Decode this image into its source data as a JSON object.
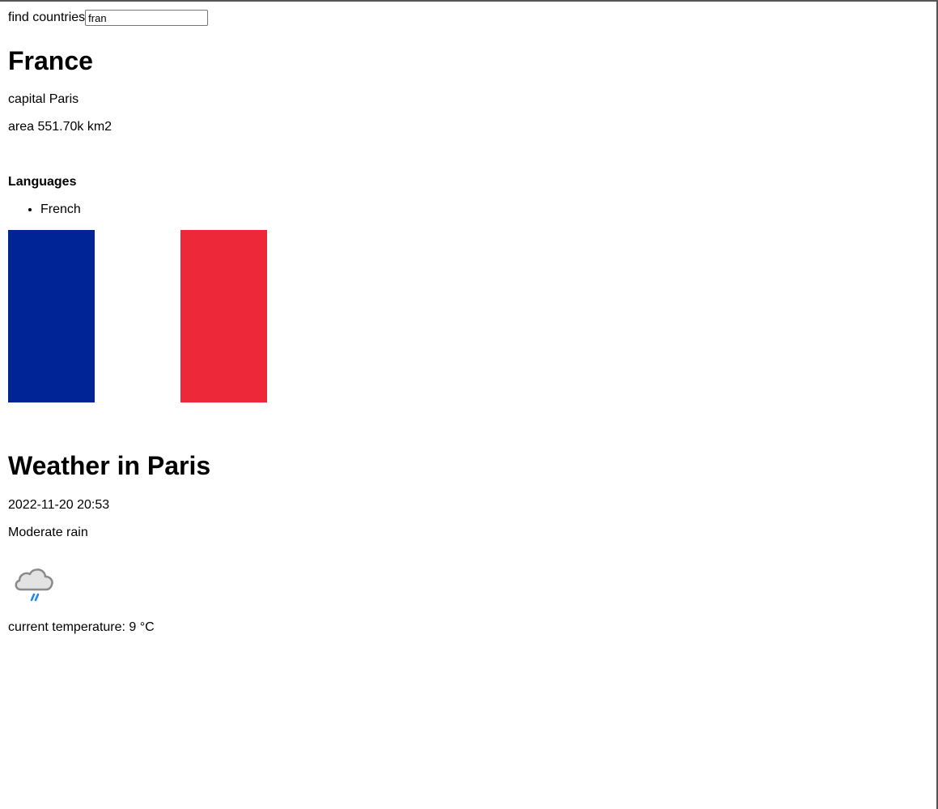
{
  "search": {
    "label": "find countries",
    "value": "fran"
  },
  "country": {
    "name": "France",
    "capital_text": "capital Paris",
    "area_text": "area 551.70k km2",
    "languages_heading": "Languages",
    "languages": [
      "French"
    ],
    "flag": {
      "icon": "flag-of-france",
      "colors": [
        "#002395",
        "#ffffff",
        "#ED2939"
      ]
    }
  },
  "weather": {
    "heading": "Weather in Paris",
    "time": "2022-11-20 20:53",
    "condition": "Moderate rain",
    "icon": "rain-cloud-icon",
    "temperature_text": "current temperature: 9 °C"
  }
}
